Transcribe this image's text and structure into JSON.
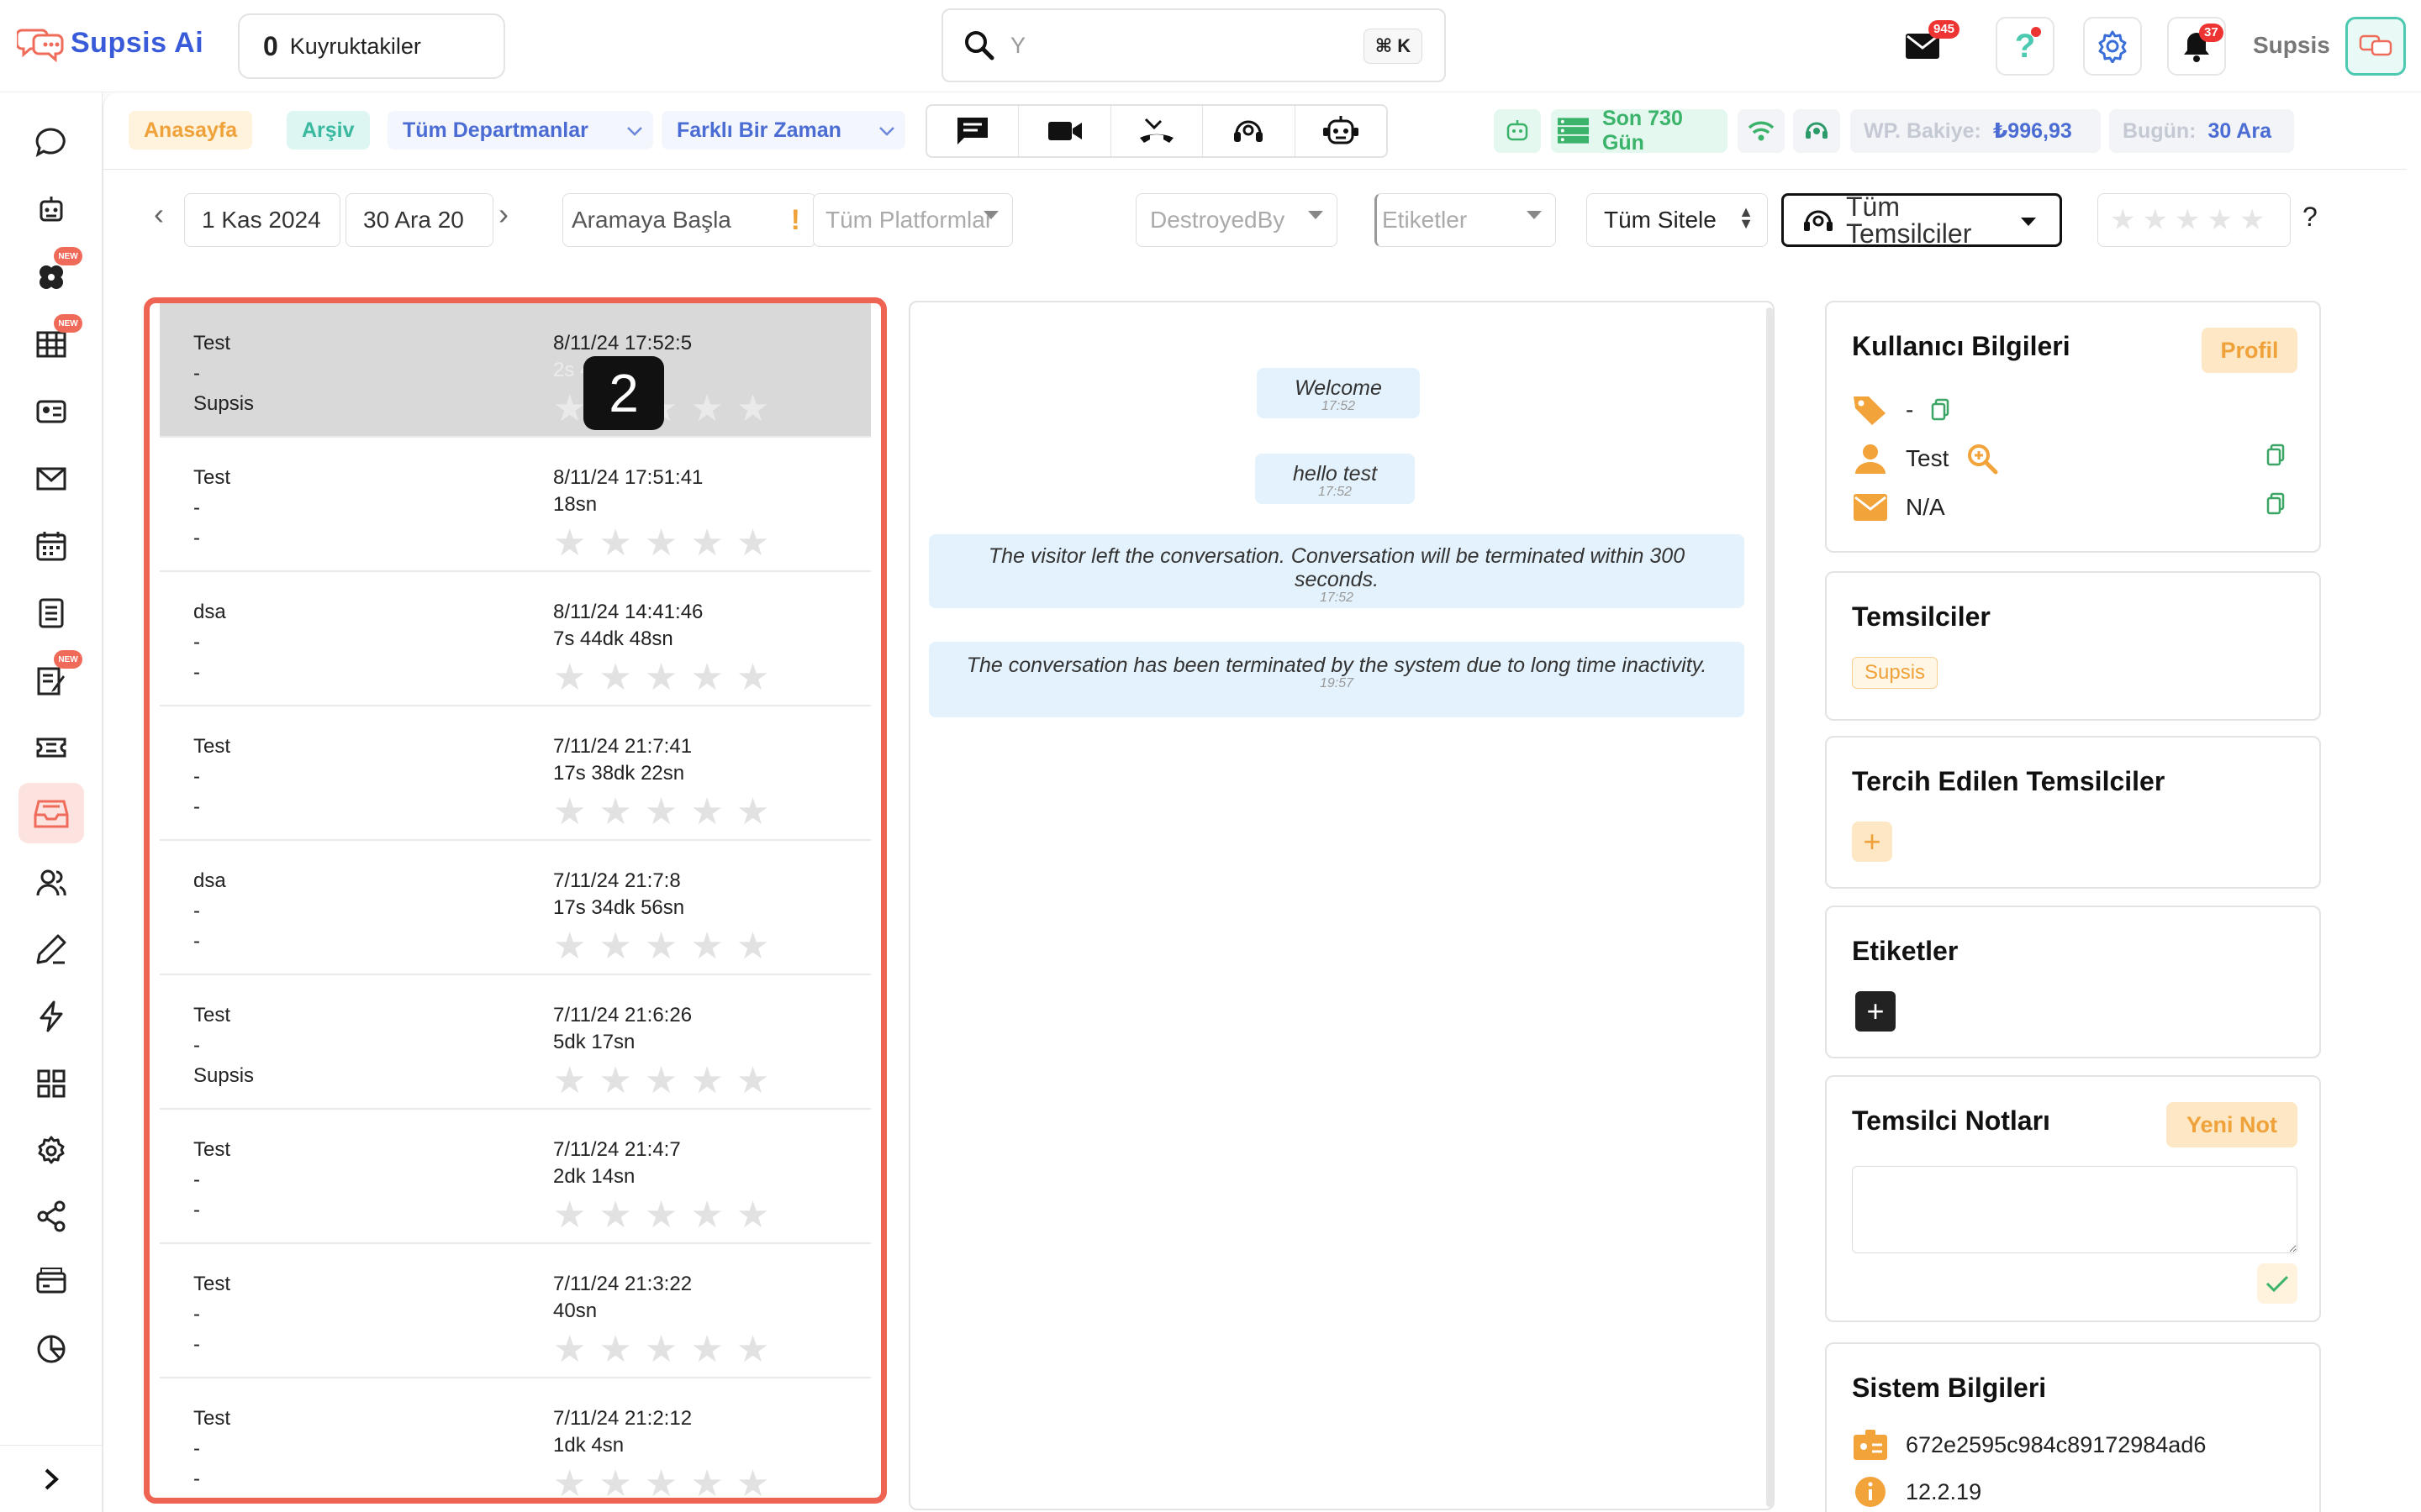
{
  "topbar": {
    "logo_text": "Supsis Ai",
    "queue_count": "0",
    "queue_label": "Kuyruktakiler",
    "search_value": "Y",
    "search_shortcut": "⌘ K",
    "mail_badge": "945",
    "notif_badge": "37",
    "username": "Supsis"
  },
  "sidebar": {
    "new_label": "NEW"
  },
  "filters1": {
    "home": "Anasayfa",
    "archive": "Arşiv",
    "departments": "Tüm Departmanlar",
    "time": "Farklı Bir Zaman",
    "range": "Son 730 Gün",
    "balance_label": "WP. Bakiye:",
    "balance_value": "₺996,93",
    "today_label": "Bugün:",
    "today_value": "30 Ara"
  },
  "filters2": {
    "date_from": "1 Kas 2024",
    "date_to": "30 Ara 20",
    "search_placeholder": "Aramaya Başla",
    "platforms": "Tüm Platformlar",
    "destroyed_by": "DestroyedBy",
    "tags": "Etiketler",
    "sites": "Tüm Sitele",
    "agents": "Tüm Temsilciler",
    "rating_help": "?"
  },
  "step_badge": "2",
  "conversations": [
    {
      "name": "Test",
      "agent": "-",
      "extra": "Supsis",
      "date": "8/11/24 17:52:5",
      "duration": "2s 4dk 55sn"
    },
    {
      "name": "Test",
      "agent": "-",
      "extra": "-",
      "date": "8/11/24 17:51:41",
      "duration": "18sn"
    },
    {
      "name": "dsa",
      "agent": "-",
      "extra": "-",
      "date": "8/11/24 14:41:46",
      "duration": "7s 44dk 48sn"
    },
    {
      "name": "Test",
      "agent": "-",
      "extra": "-",
      "date": "7/11/24 21:7:41",
      "duration": "17s 38dk 22sn"
    },
    {
      "name": "dsa",
      "agent": "-",
      "extra": "-",
      "date": "7/11/24 21:7:8",
      "duration": "17s 34dk 56sn"
    },
    {
      "name": "Test",
      "agent": "-",
      "extra": "Supsis",
      "date": "7/11/24 21:6:26",
      "duration": "5dk 17sn"
    },
    {
      "name": "Test",
      "agent": "-",
      "extra": "-",
      "date": "7/11/24 21:4:7",
      "duration": "2dk 14sn"
    },
    {
      "name": "Test",
      "agent": "-",
      "extra": "-",
      "date": "7/11/24 21:3:22",
      "duration": "40sn"
    },
    {
      "name": "Test",
      "agent": "-",
      "extra": "-",
      "date": "7/11/24 21:2:12",
      "duration": "1dk 4sn"
    }
  ],
  "chat": {
    "messages": [
      {
        "text": "Welcome",
        "time": "17:52"
      },
      {
        "text": "hello test",
        "time": "17:52"
      },
      {
        "text": "The visitor left the conversation. Conversation will be terminated within 300 seconds.",
        "time": "17:52"
      },
      {
        "text": "The conversation has been terminated by the system due to long time inactivity.",
        "time": "19:57"
      }
    ]
  },
  "right": {
    "user_info_title": "Kullanıcı Bilgileri",
    "profile_btn": "Profil",
    "tag_value": "-",
    "user_name": "Test",
    "user_email": "N/A",
    "agents_title": "Temsilciler",
    "agent_tag": "Supsis",
    "preferred_title": "Tercih Edilen Temsilciler",
    "tags_title": "Etiketler",
    "notes_title": "Temsilci Notları",
    "new_note_btn": "Yeni Not",
    "system_title": "Sistem Bilgileri",
    "system_id": "672e2595c984c89172984ad6",
    "system_version": "12.2.19"
  }
}
